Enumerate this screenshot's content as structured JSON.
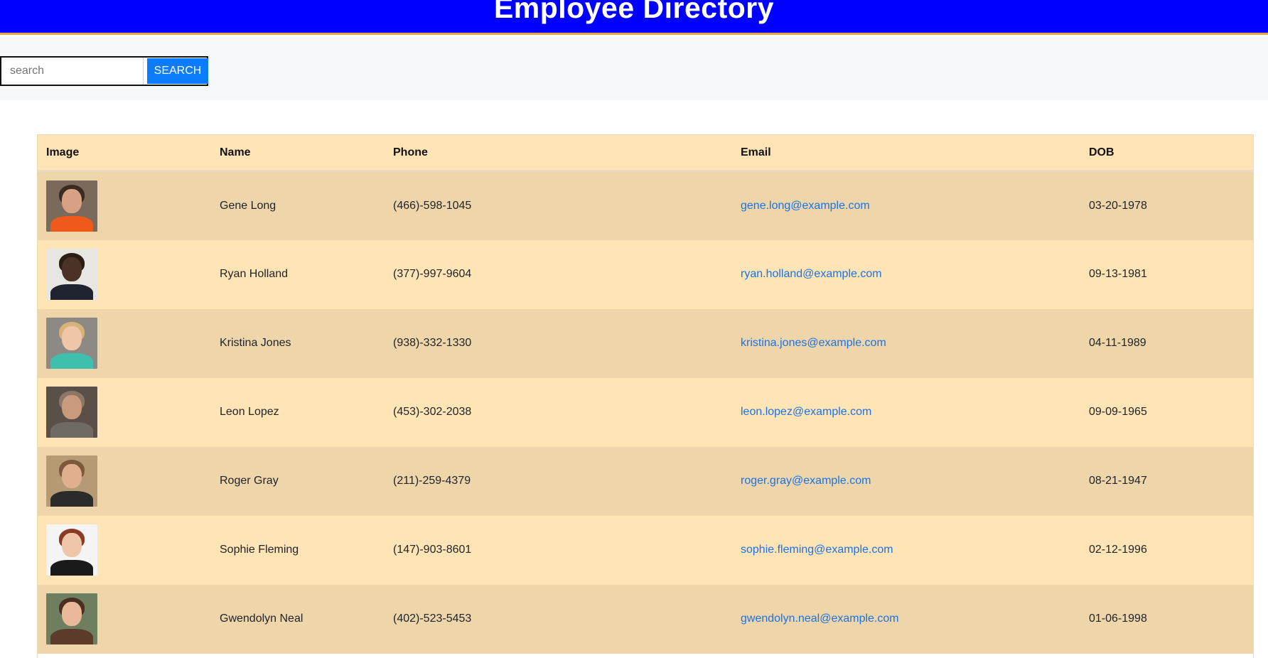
{
  "header": {
    "title": "Employee Directory"
  },
  "search": {
    "placeholder": "search",
    "value": "",
    "button_label": "SEARCH"
  },
  "table": {
    "columns": [
      "Image",
      "Name",
      "Phone",
      "Email",
      "DOB"
    ],
    "rows": [
      {
        "name": "Gene Long",
        "phone": "(466)-598-1045",
        "email": "gene.long@example.com",
        "dob": "03-20-1978",
        "avatar": {
          "bg": "#7a6a5c",
          "skin": "#d9a184",
          "hair": "#3a2a20",
          "shirt": "#ef5a1c"
        }
      },
      {
        "name": "Ryan Holland",
        "phone": "(377)-997-9604",
        "email": "ryan.holland@example.com",
        "dob": "09-13-1981",
        "avatar": {
          "bg": "#e8e6e2",
          "skin": "#4a3226",
          "hair": "#2c1d15",
          "shirt": "#1f2430"
        }
      },
      {
        "name": "Kristina Jones",
        "phone": "(938)-332-1330",
        "email": "kristina.jones@example.com",
        "dob": "04-11-1989",
        "avatar": {
          "bg": "#8d8a86",
          "skin": "#efc7a8",
          "hair": "#d7b27a",
          "shirt": "#3fbfae"
        }
      },
      {
        "name": "Leon Lopez",
        "phone": "(453)-302-2038",
        "email": "leon.lopez@example.com",
        "dob": "09-09-1965",
        "avatar": {
          "bg": "#5b5048",
          "skin": "#c99a7c",
          "hair": "#8a7768",
          "shirt": "#6f6a62"
        }
      },
      {
        "name": "Roger Gray",
        "phone": "(211)-259-4379",
        "email": "roger.gray@example.com",
        "dob": "08-21-1947",
        "avatar": {
          "bg": "#b59a73",
          "skin": "#e0b08e",
          "hair": "#7a5a3a",
          "shirt": "#2b2b2b"
        }
      },
      {
        "name": "Sophie Fleming",
        "phone": "(147)-903-8601",
        "email": "sophie.fleming@example.com",
        "dob": "02-12-1996",
        "avatar": {
          "bg": "#f4f4f4",
          "skin": "#f0c6aa",
          "hair": "#8a3b25",
          "shirt": "#1a1a1a"
        }
      },
      {
        "name": "Gwendolyn Neal",
        "phone": "(402)-523-5453",
        "email": "gwendolyn.neal@example.com",
        "dob": "01-06-1998",
        "avatar": {
          "bg": "#6e7f5f",
          "skin": "#e8b898",
          "hair": "#4a2e1f",
          "shirt": "#5c3b2a"
        }
      }
    ]
  },
  "colors": {
    "header_bg": "#0000ff",
    "header_border": "#e5a43a",
    "search_button": "#0b7bff",
    "row_light": "#ffe4b5",
    "row_dark": "#eed5aa",
    "link": "#1a73e8"
  }
}
